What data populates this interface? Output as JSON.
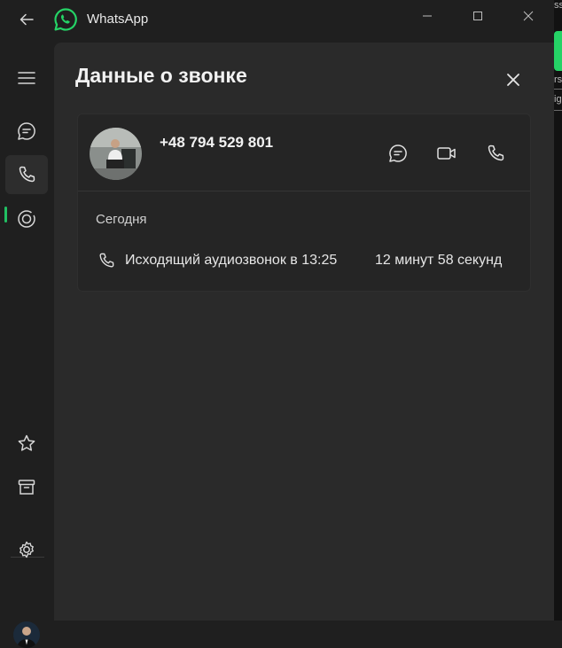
{
  "app": {
    "title": "WhatsApp",
    "accent_color": "#21c063"
  },
  "window_controls": [
    "minimize-icon",
    "maximize-icon",
    "close-icon"
  ],
  "rail": {
    "items": [
      {
        "name": "menu",
        "icon": "hamburger-icon",
        "active": false
      },
      {
        "name": "chats",
        "icon": "chat-icon",
        "active": false
      },
      {
        "name": "calls",
        "icon": "phone-icon",
        "active": true
      },
      {
        "name": "status",
        "icon": "status-icon",
        "active": false
      },
      {
        "name": "starred",
        "icon": "star-icon",
        "active": false
      },
      {
        "name": "archived",
        "icon": "archive-icon",
        "active": false
      },
      {
        "name": "settings",
        "icon": "gear-icon",
        "active": false
      },
      {
        "name": "profile",
        "icon": "avatar",
        "active": false
      }
    ]
  },
  "panel": {
    "title": "Данные о звонке",
    "contact": {
      "phone": "+48 794 529 801",
      "actions": [
        "message-icon",
        "video-call-icon",
        "voice-call-icon"
      ]
    },
    "history": {
      "day": "Сегодня",
      "calls": [
        {
          "description": "Исходящий аудиозвонок в 13:25",
          "duration": "12 минут 58 секунд",
          "icon": "phone-icon"
        }
      ]
    }
  },
  "edge_fragment": {
    "texts": [
      "ss",
      "rs",
      "ig"
    ]
  }
}
